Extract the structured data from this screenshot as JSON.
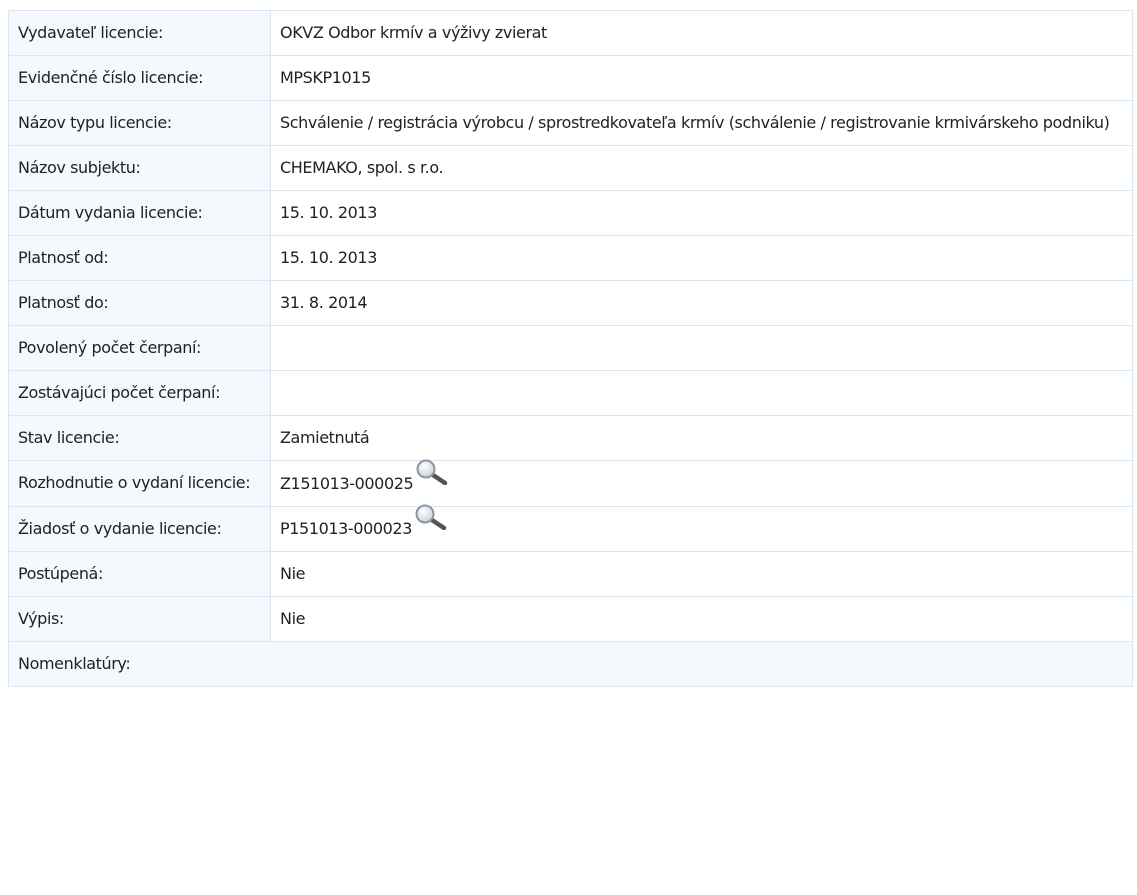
{
  "rows": [
    {
      "label": "Vydavateľ licencie:",
      "value": "OKVZ Odbor krmív a výživy zvierat"
    },
    {
      "label": "Evidenčné číslo licencie:",
      "value": "MPSKP1015"
    },
    {
      "label": "Názov typu licencie:",
      "value": "Schválenie / registrácia výrobcu / sprostredkovateľa krmív (schválenie / registrovanie krmivárskeho podniku)"
    },
    {
      "label": "Názov subjektu:",
      "value": "CHEMAKO, spol. s r.o."
    },
    {
      "label": "Dátum vydania licencie:",
      "value": "15. 10. 2013"
    },
    {
      "label": "Platnosť od:",
      "value": "15. 10. 2013"
    },
    {
      "label": "Platnosť do:",
      "value": "31. 8. 2014"
    },
    {
      "label": "Povolený počet čerpaní:",
      "value": ""
    },
    {
      "label": "Zostávajúci počet čerpaní:",
      "value": ""
    },
    {
      "label": "Stav licencie:",
      "value": "Zamietnutá"
    },
    {
      "label": "Rozhodnutie o vydaní licencie:",
      "value": "Z151013-000025",
      "icon": "magnifier-icon"
    },
    {
      "label": "Žiadosť o vydanie licencie:",
      "value": "P151013-000023",
      "icon": "magnifier-icon"
    },
    {
      "label": "Postúpená:",
      "value": "Nie"
    },
    {
      "label": "Výpis:",
      "value": "Nie"
    },
    {
      "label": "Nomenklatúry:",
      "value": ""
    }
  ],
  "colors": {
    "border": "#dce6f1",
    "label_bg": "#f5f8fc",
    "text": "#222222"
  }
}
